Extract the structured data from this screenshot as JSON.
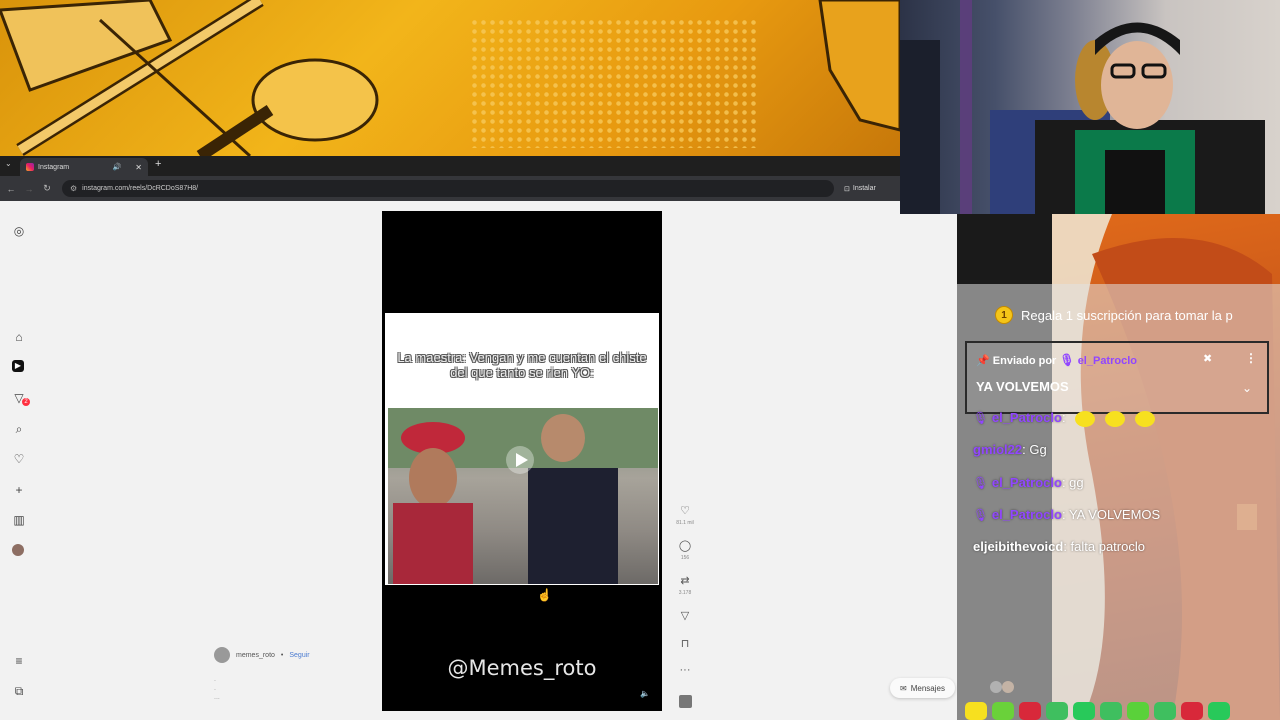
{
  "browser": {
    "tab_title": "Instagram",
    "url": "instagram.com/reels/DcRCDoS87H8/",
    "install_label": "Instalar"
  },
  "reel": {
    "meme_text": "La maestra: Vengan y me cuentan el chiste del que tanto se rien YO:",
    "watermark": "@Memes_roto",
    "author": "memes_roto",
    "follow_label": "Seguir",
    "likes": "81.1 mil",
    "comments": "156",
    "reposts": "3.178"
  },
  "sidebar": {
    "notification_count": "2"
  },
  "messages_label": "Mensajes",
  "chat": {
    "gift_number": "1",
    "gift_text": "Regala 1 suscripción para tomar la p",
    "pinned": {
      "sent_by": "Enviado por",
      "user": "el_Patroclo",
      "message": "YA VOLVEMOS"
    },
    "lines": [
      {
        "user": "el_Patroclo",
        "text": ":"
      },
      {
        "user": "gmiol22",
        "text": ": Gg"
      },
      {
        "user": "el_Patroclo",
        "text": ": gg"
      },
      {
        "user": "el_Patroclo",
        "text": ": YA VOLVEMOS"
      },
      {
        "user": "eljeibithevoicd",
        "text": ": falta patroclo"
      }
    ],
    "colors": {
      "accent": "#9146ff",
      "gold": "#f5c518"
    }
  }
}
